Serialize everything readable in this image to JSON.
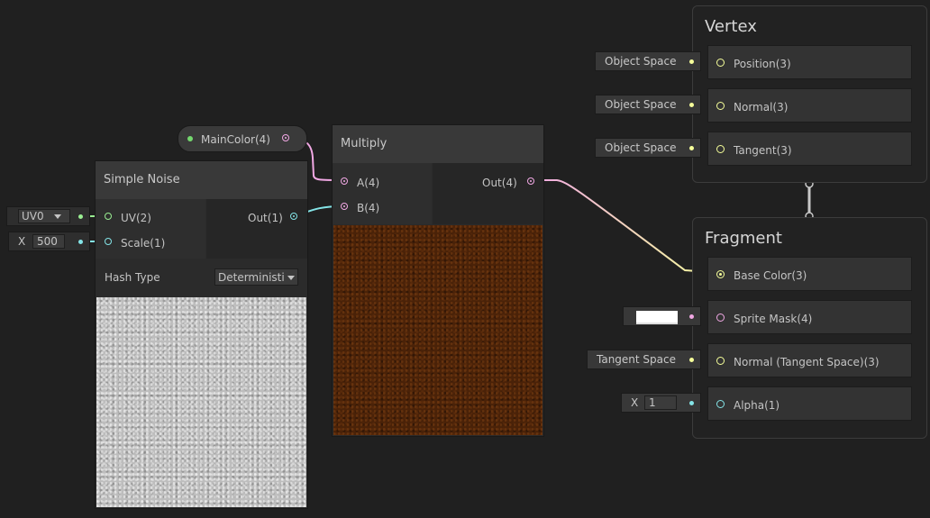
{
  "colors": {
    "canvas": "#202020",
    "node_body": "#2b2b2b",
    "node_title": "#393939",
    "vector4_port": "#f1a8e4",
    "vector3_port": "#f6ff9a",
    "vector2_port": "#9aef92",
    "vector1_port": "#84e4e7"
  },
  "property_node": {
    "label": "MainColor(4)"
  },
  "simple_noise": {
    "title": "Simple Noise",
    "inputs": [
      "UV(2)",
      "Scale(1)"
    ],
    "output": "Out(1)",
    "uv_select": "UV0",
    "scale_axis": "X",
    "scale_value": "500",
    "hash_type_label": "Hash Type",
    "hash_type_value": "Deterministi"
  },
  "multiply": {
    "title": "Multiply",
    "input_a": "A(4)",
    "input_b": "B(4)",
    "output": "Out(4)"
  },
  "vertex": {
    "title": "Vertex",
    "blocks": [
      {
        "space": "Object Space",
        "label": "Position(3)"
      },
      {
        "space": "Object Space",
        "label": "Normal(3)"
      },
      {
        "space": "Object Space",
        "label": "Tangent(3)"
      }
    ]
  },
  "fragment": {
    "title": "Fragment",
    "base_color": "Base Color(3)",
    "sprite_mask": "Sprite Mask(4)",
    "normal_space": "Tangent Space",
    "normal": "Normal (Tangent Space)(3)",
    "alpha_axis": "X",
    "alpha_value": "1",
    "alpha": "Alpha(1)"
  }
}
